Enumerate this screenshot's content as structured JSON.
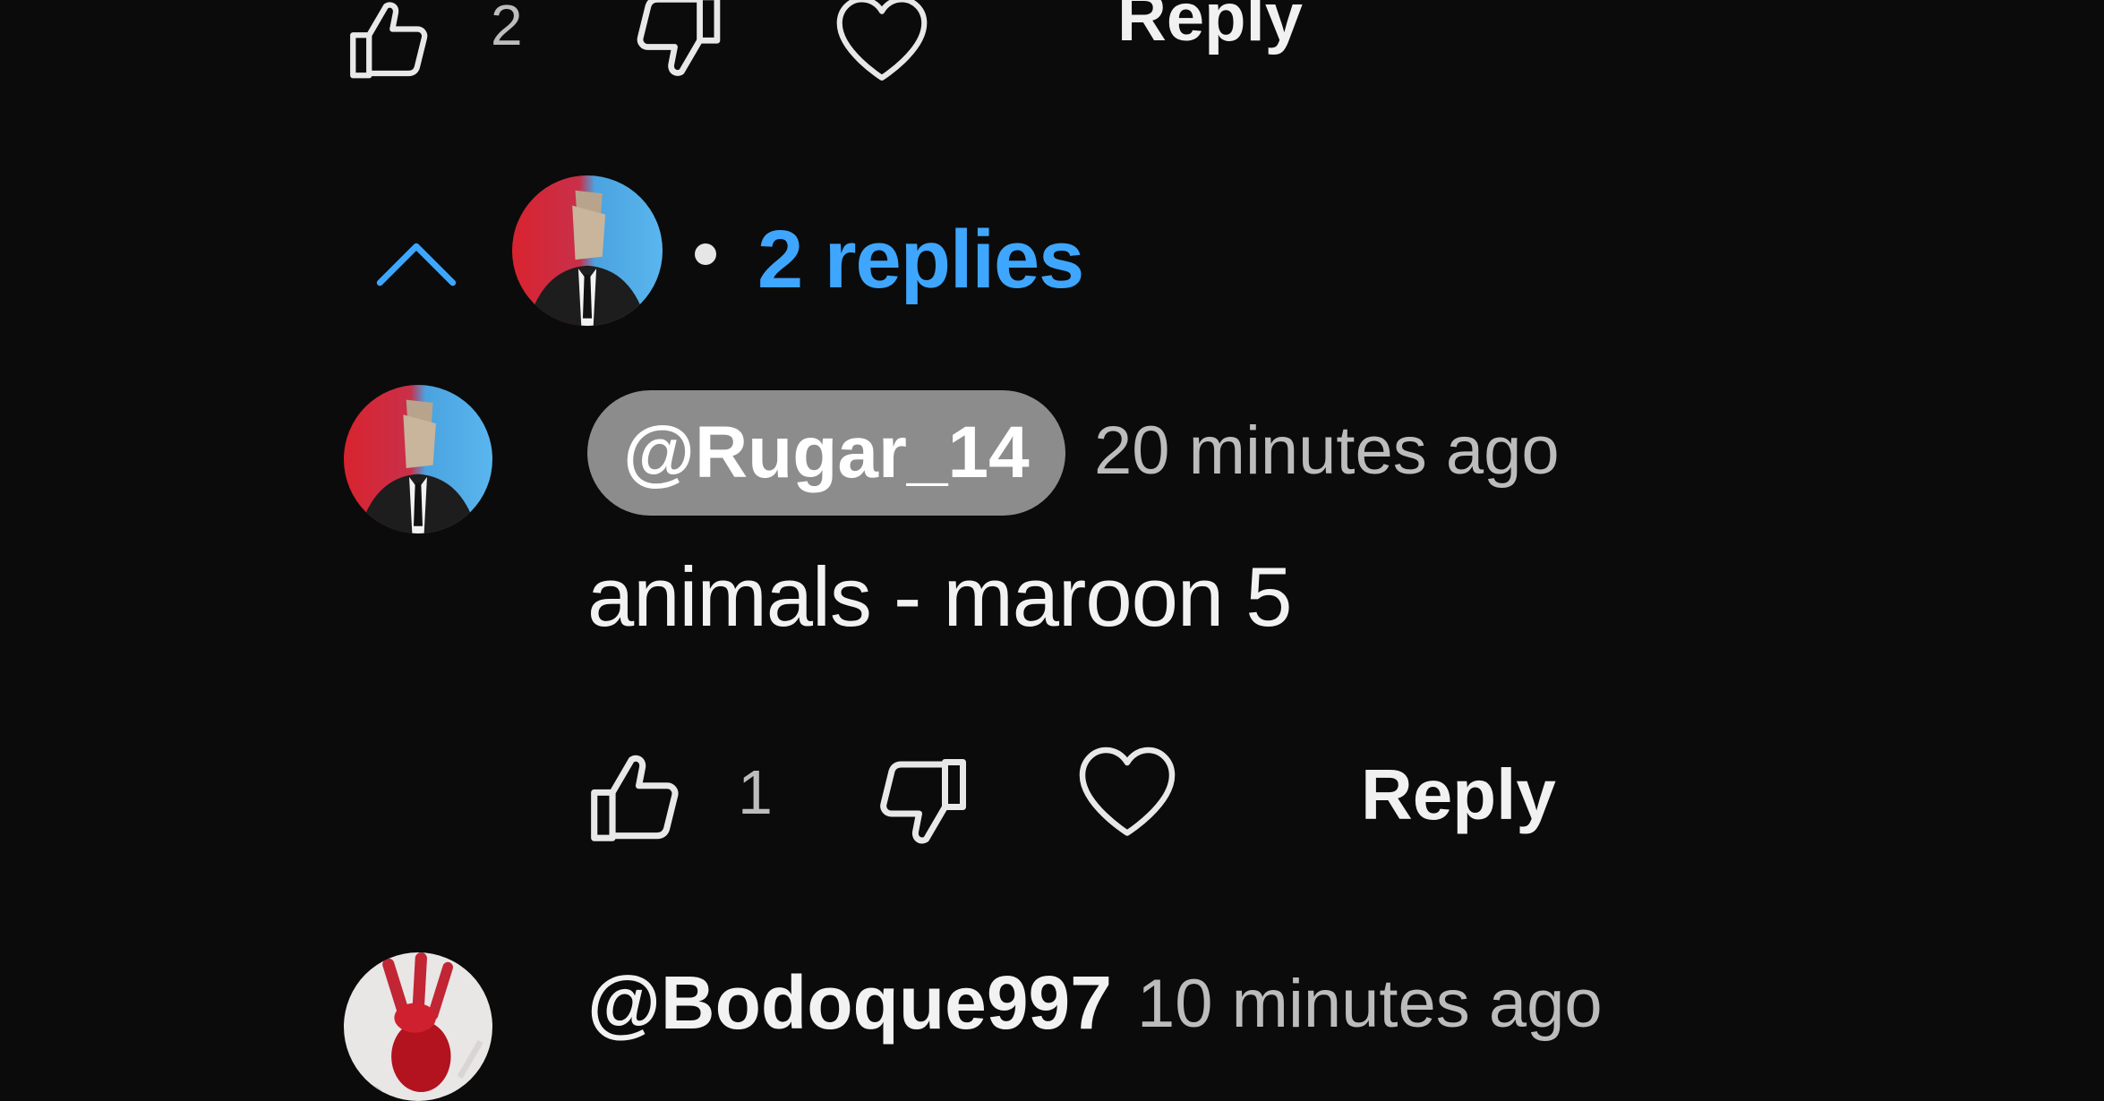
{
  "top_comment_actions": {
    "like_count": "2",
    "reply_label": "Reply"
  },
  "replies_toggle": {
    "label": "2 replies",
    "accent_color": "#3ea6ff"
  },
  "reply": {
    "author": "@Rugar_14",
    "time": "20 minutes ago",
    "text": "animals - maroon 5",
    "like_count": "1",
    "reply_label": "Reply"
  },
  "next_comment": {
    "author": "@Bodoque997",
    "time": "10 minutes ago"
  },
  "icons": {
    "like": "thumbs-up-icon",
    "dislike": "thumbs-down-icon",
    "heart": "heart-icon",
    "collapse": "chevron-up-icon"
  },
  "colors": {
    "background": "#0b0b0b",
    "pill": "#8c8c8c"
  }
}
